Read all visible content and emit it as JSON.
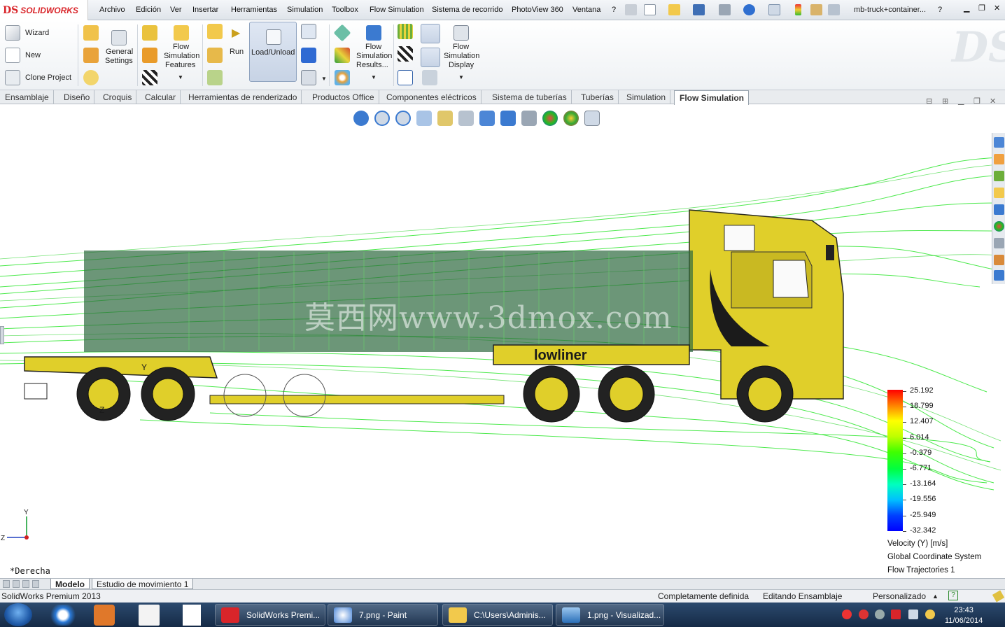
{
  "app": {
    "logo_text": "SOLIDWORKS",
    "document_title": "mb-truck+container...",
    "help_icon": "?"
  },
  "menu": [
    "Archivo",
    "Edición",
    "Ver",
    "Insertar",
    "Herramientas",
    "Simulation",
    "Toolbox",
    "Flow Simulation",
    "Sistema de recorrido",
    "PhotoView 360",
    "Ventana",
    "?"
  ],
  "ribbon": {
    "wizard": "Wizard",
    "new": "New",
    "clone_project": "Clone Project",
    "general_settings_1": "General",
    "general_settings_2": "Settings",
    "features_1": "Flow",
    "features_2": "Simulation",
    "features_3": "Features",
    "run": "Run",
    "load_unload": "Load/Unload",
    "results_1": "Flow",
    "results_2": "Simulation",
    "results_3": "Results...",
    "display_1": "Flow",
    "display_2": "Simulation",
    "display_3": "Display"
  },
  "tabs": [
    "Ensamblaje",
    "Diseño",
    "Croquis",
    "Calcular",
    "Herramientas de renderizado",
    "Productos Office",
    "Componentes eléctricos",
    "Sistema de tuberías",
    "Tuberías",
    "Simulation",
    "Flow Simulation"
  ],
  "active_tab": "Flow Simulation",
  "viewport": {
    "view_name": "*Derecha",
    "watermark": "莫西网www.3dmox.com",
    "brand_on_trailer": "lowliner",
    "triad": {
      "y": "Y",
      "z": "Z"
    }
  },
  "legend": {
    "values": [
      "25.192",
      "18.799",
      "12.407",
      "6.014",
      "-0.379",
      "-6.771",
      "-13.164",
      "-19.556",
      "-25.949",
      "-32.342"
    ],
    "colors": [
      "#ff0000",
      "#ff8000",
      "#ffff00",
      "#bfff00",
      "#40ff00",
      "#00ff40",
      "#00ffbf",
      "#00bfff",
      "#0040ff",
      "#0000ff"
    ],
    "parameter": "Velocity (Y) [m/s]",
    "coordinate_system": "Global Coordinate System",
    "plot_name": "Flow Trajectories 1"
  },
  "model_tabs": [
    "Modelo",
    "Estudio de movimiento 1"
  ],
  "status": {
    "product": "SolidWorks Premium 2013",
    "definition": "Completamente definida",
    "mode": "Editando Ensamblaje",
    "units": "Personalizado"
  },
  "taskbar": {
    "tasks": [
      "SolidWorks Premi...",
      "7.png - Paint",
      "C:\\Users\\Adminis...",
      "1.png - Visualizad..."
    ],
    "time": "23:43",
    "date": "11/06/2014"
  }
}
